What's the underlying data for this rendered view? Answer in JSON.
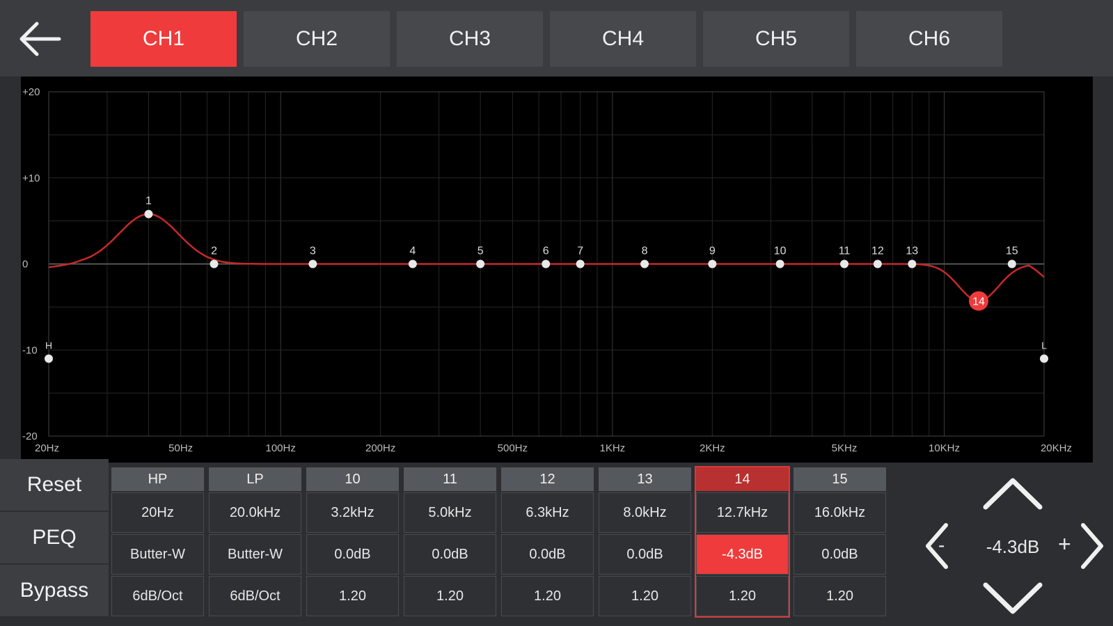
{
  "back_icon": "arrow-left-icon",
  "channels": [
    {
      "label": "CH1",
      "active": true
    },
    {
      "label": "CH2",
      "active": false
    },
    {
      "label": "CH3",
      "active": false
    },
    {
      "label": "CH4",
      "active": false
    },
    {
      "label": "CH5",
      "active": false
    },
    {
      "label": "CH6",
      "active": false
    }
  ],
  "graph": {
    "y_labels": [
      "+20",
      "+10",
      "0",
      "-10",
      "-20"
    ],
    "x_labels": [
      "20Hz",
      "50Hz",
      "100Hz",
      "200Hz",
      "500Hz",
      "1KHz",
      "2KHz",
      "5KHz",
      "10KHz",
      "20KHz"
    ],
    "points": [
      {
        "label": "1",
        "freq": 40,
        "gain": 5.8
      },
      {
        "label": "2",
        "freq": 63,
        "gain": 0
      },
      {
        "label": "3",
        "freq": 125,
        "gain": 0
      },
      {
        "label": "4",
        "freq": 250,
        "gain": 0
      },
      {
        "label": "5",
        "freq": 400,
        "gain": 0
      },
      {
        "label": "6",
        "freq": 630,
        "gain": 0
      },
      {
        "label": "7",
        "freq": 800,
        "gain": 0
      },
      {
        "label": "8",
        "freq": 1250,
        "gain": 0
      },
      {
        "label": "9",
        "freq": 2000,
        "gain": 0
      },
      {
        "label": "10",
        "freq": 3200,
        "gain": 0
      },
      {
        "label": "11",
        "freq": 5000,
        "gain": 0
      },
      {
        "label": "12",
        "freq": 6300,
        "gain": 0
      },
      {
        "label": "13",
        "freq": 8000,
        "gain": 0
      },
      {
        "label": "14",
        "freq": 12700,
        "gain": -4.3,
        "selected": true
      },
      {
        "label": "15",
        "freq": 16000,
        "gain": 0
      }
    ],
    "hp": {
      "label": "H",
      "freq": 20
    },
    "lp": {
      "label": "L",
      "freq": 20000
    },
    "curve_color": "#c82828",
    "selected_color": "#ef3b3b"
  },
  "side_buttons": [
    "Reset",
    "PEQ",
    "Bypass"
  ],
  "bands": [
    {
      "head": "HP",
      "freq": "20Hz",
      "gain": "Butter-W",
      "q": "6dB/Oct",
      "selected": false
    },
    {
      "head": "LP",
      "freq": "20.0kHz",
      "gain": "Butter-W",
      "q": "6dB/Oct",
      "selected": false
    },
    {
      "head": "10",
      "freq": "3.2kHz",
      "gain": "0.0dB",
      "q": "1.20",
      "selected": false
    },
    {
      "head": "11",
      "freq": "5.0kHz",
      "gain": "0.0dB",
      "q": "1.20",
      "selected": false
    },
    {
      "head": "12",
      "freq": "6.3kHz",
      "gain": "0.0dB",
      "q": "1.20",
      "selected": false
    },
    {
      "head": "13",
      "freq": "8.0kHz",
      "gain": "0.0dB",
      "q": "1.20",
      "selected": false
    },
    {
      "head": "14",
      "freq": "12.7kHz",
      "gain": "-4.3dB",
      "q": "1.20",
      "selected": true
    },
    {
      "head": "15",
      "freq": "16.0kHz",
      "gain": "0.0dB",
      "q": "1.20",
      "selected": false
    }
  ],
  "pad": {
    "value": "-4.3dB",
    "minus_label": "-",
    "plus_label": "+",
    "up_icon": "chevron-up-icon",
    "down_icon": "chevron-down-icon",
    "left_icon": "chevron-left-icon",
    "right_icon": "chevron-right-icon"
  }
}
